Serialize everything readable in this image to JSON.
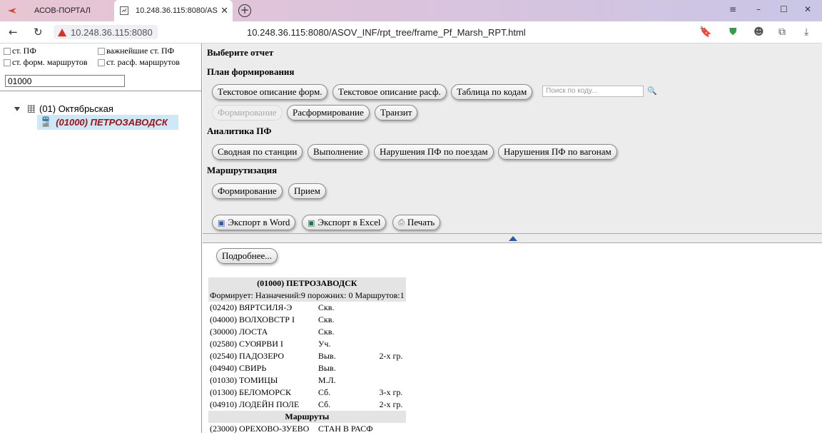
{
  "browser": {
    "tab1_title": "АСОВ-ПОРТАЛ",
    "tab2_title": "10.248.36.115:8080/AS",
    "address_host": "10.248.36.115:8080",
    "url": "10.248.36.115:8080/ASOV_INF/rpt_tree/frame_Pf_Marsh_RPT.html"
  },
  "filters": {
    "st_pf": "ст. ПФ",
    "important_st_pf": "важнейшие ст. ПФ",
    "st_form": "ст. форм. маршрутов",
    "st_rasf": "ст. расф. маршрутов",
    "code_value": "01000"
  },
  "tree": {
    "root": "(01) Октябрьская",
    "selected": "(01000) ПЕТРОЗАВОДСК"
  },
  "report": {
    "choose": "Выберите отчет",
    "plan": "План формирования",
    "btn_text_form": "Текстовое описание форм.",
    "btn_text_rasf": "Текстовое описание расф.",
    "btn_table": "Таблица по кодам",
    "search_placeholder": "Поиск по коду...",
    "btn_form": "Формирование",
    "btn_rasform": "Расформирование",
    "btn_transit": "Транзит",
    "analytics": "Аналитика ПФ",
    "btn_summary": "Сводная по станции",
    "btn_exec": "Выполнение",
    "btn_viol_trains": "Нарушения ПФ по поездам",
    "btn_viol_wagons": "Нарушения ПФ по вагонам",
    "routing": "Маршрутизация",
    "btn_r_form": "Формирование",
    "btn_receive": "Прием",
    "btn_word": "Экспорт в Word",
    "btn_excel": "Экспорт в Excel",
    "btn_print": "Печать"
  },
  "details": {
    "more": "Подробнее...",
    "station": "(01000) ПЕТРОЗАВОДСК",
    "summary": "Формирует: Назначений:9 порожних: 0 Маршрутов:1",
    "rows": [
      {
        "dest": "(02420) ВЯРТСИЛЯ-Э",
        "type": "Скв.",
        "gr": ""
      },
      {
        "dest": "(04000) ВОЛХОВСТР I",
        "type": "Скв.",
        "gr": ""
      },
      {
        "dest": "(30000) ЛОСТА",
        "type": "Скв.",
        "gr": ""
      },
      {
        "dest": "(02580) СУОЯРВИ I",
        "type": "Уч.",
        "gr": ""
      },
      {
        "dest": "(02540) ПАДОЗЕРО",
        "type": "Выв.",
        "gr": "2-х гр."
      },
      {
        "dest": "(04940) СВИРЬ",
        "type": "Выв.",
        "gr": ""
      },
      {
        "dest": "(01030) ТОМИЦЫ",
        "type": "М.Л.",
        "gr": ""
      },
      {
        "dest": "(01300) БЕЛОМОРСК",
        "type": "Сб.",
        "gr": "3-х гр."
      },
      {
        "dest": "(04910) ЛОДЕЙН ПОЛЕ",
        "type": "Сб.",
        "gr": "2-х гр."
      }
    ],
    "routes_header": "Маршруты",
    "route_rows": [
      {
        "dest": "(23000) ОРЕХОВО-ЗУЕВО",
        "type": "СТАН В РАСФ",
        "gr": ""
      }
    ]
  }
}
